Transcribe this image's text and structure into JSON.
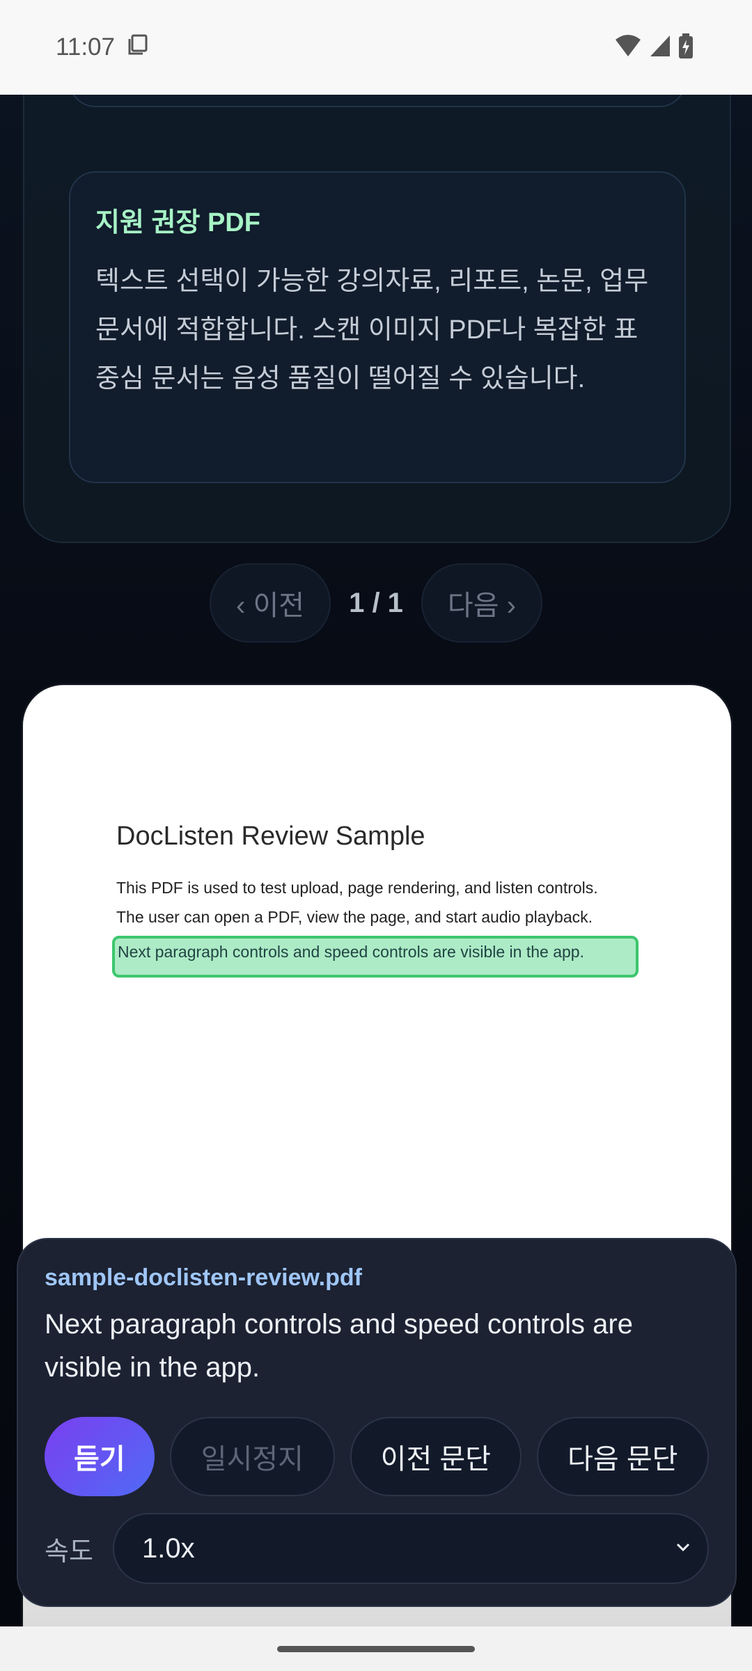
{
  "status_bar": {
    "time": "11:07"
  },
  "info_card": {
    "title": "지원 권장 PDF",
    "body": "텍스트 선택이 가능한 강의자료, 리포트, 논문, 업무 문서에 적합합니다. 스캔 이미지 PDF나 복잡한 표 중심 문서는 음성 품질이 떨어질 수 있습니다."
  },
  "pager": {
    "prev_label": "‹ 이전",
    "count": "1 / 1",
    "next_label": "다음 ›"
  },
  "pdf": {
    "title": "DocListen Review Sample",
    "lines": [
      "This PDF is used to test upload, page rendering, and listen controls.",
      "The user can open a PDF, view the page, and start audio playback.",
      "Next paragraph controls and speed controls are visible in the app."
    ],
    "highlight_color": "#acebc6"
  },
  "player": {
    "file_name": "sample-doclisten-review.pdf",
    "current_text": "Next paragraph controls and speed controls are visible in the app.",
    "listen_label": "듣기",
    "pause_label": "일시정지",
    "prev_paragraph_label": "이전 문단",
    "next_paragraph_label": "다음 문단",
    "speed_label": "속도",
    "speed_value": "1.0x"
  },
  "colors": {
    "accent_title": "#a7f3c6",
    "file_name": "#9fc6f7",
    "listen_gradient_start": "#7b3ff0",
    "listen_gradient_end": "#4f6af5"
  }
}
